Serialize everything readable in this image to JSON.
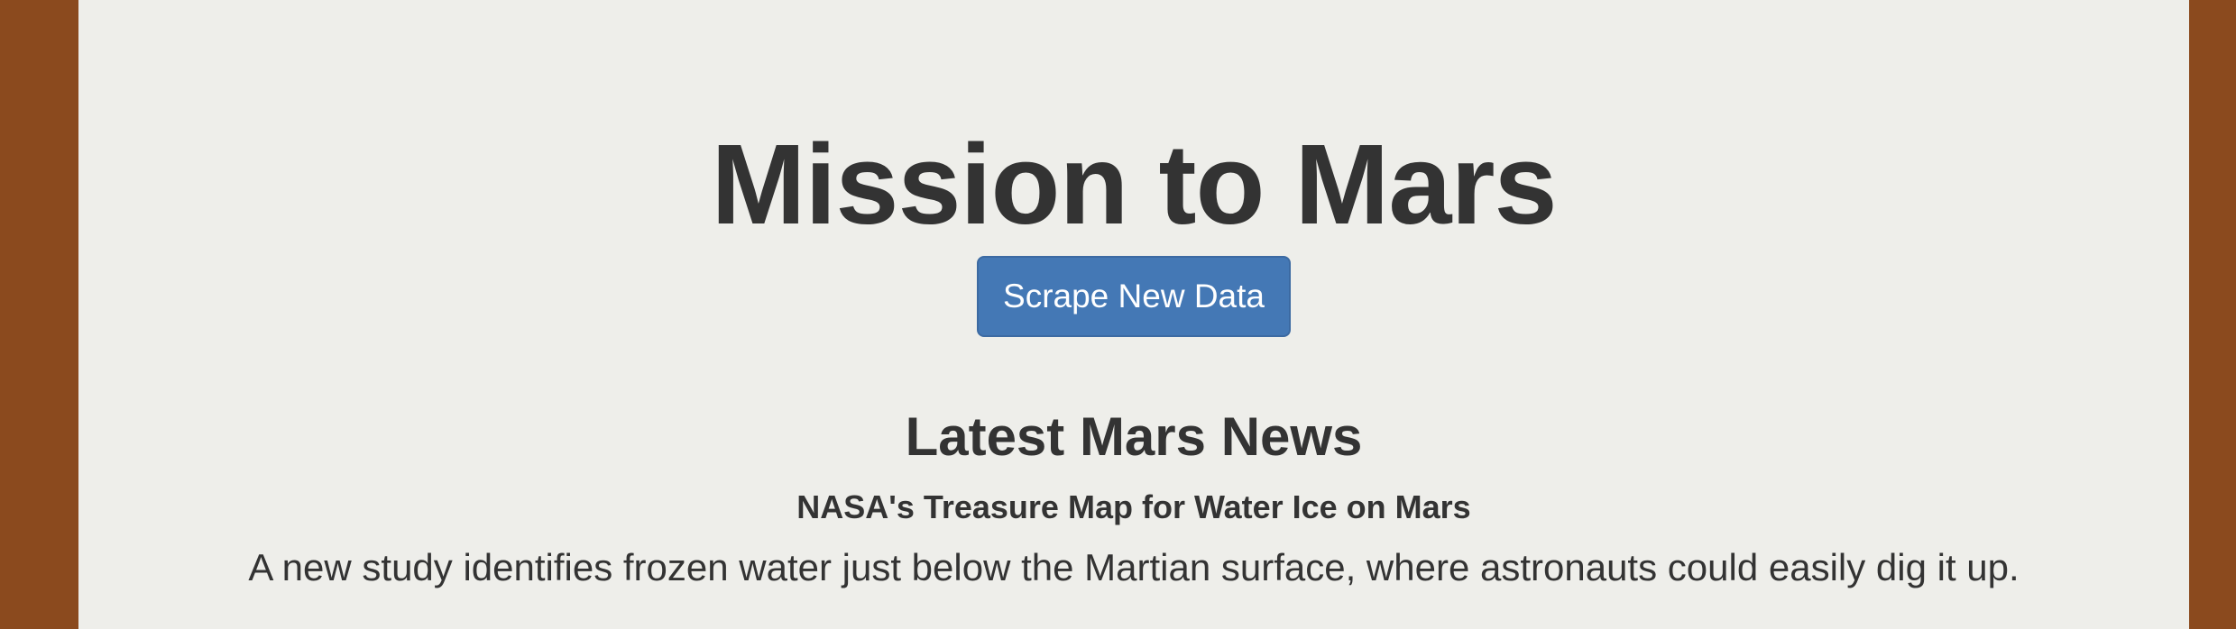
{
  "header": {
    "title": "Mission to Mars",
    "scrape_button_label": "Scrape New Data"
  },
  "news": {
    "heading": "Latest Mars News",
    "title": "NASA's Treasure Map for Water Ice on Mars",
    "teaser": "A new study identifies frozen water just below the Martian surface, where astronauts could easily dig it up."
  },
  "colors": {
    "page_border": "#8b4a1e",
    "page_background": "#eeeeea",
    "button": "#4478b5",
    "text": "#333333"
  }
}
